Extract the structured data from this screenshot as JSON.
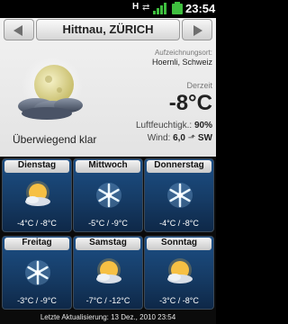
{
  "status_bar": {
    "indicator": "H",
    "time": "23:54",
    "colors": {
      "signal": "#3fbf3f",
      "battery": "#3fbf3f"
    }
  },
  "header": {
    "city": "Hittnau, ZÜRICH"
  },
  "current": {
    "station_label": "Aufzeichnungsort:",
    "station": "Hoernli, Schweiz",
    "now_label": "Derzeit",
    "temperature": "-8°C",
    "humidity_label": "Luftfeuchtigk.:",
    "humidity": "90%",
    "wind_label": "Wind:",
    "wind": "6,0",
    "wind_dir": "SW",
    "condition": "Überwiegend klar",
    "icon": "moon-clouds-icon"
  },
  "forecast": [
    {
      "day": "Dienstag",
      "icon": "sun-cloud-icon",
      "temps": "-4°C / -8°C"
    },
    {
      "day": "Mittwoch",
      "icon": "snowflake-icon",
      "temps": "-5°C / -9°C"
    },
    {
      "day": "Donnerstag",
      "icon": "snowflake-icon",
      "temps": "-4°C / -8°C"
    },
    {
      "day": "Freitag",
      "icon": "snowflake-icon",
      "temps": "-3°C / -9°C"
    },
    {
      "day": "Samstag",
      "icon": "sun-cloud-icon",
      "temps": "-7°C / -12°C"
    },
    {
      "day": "Sonntag",
      "icon": "sun-cloud-icon",
      "temps": "-3°C / -8°C"
    }
  ],
  "footer": {
    "text": "Letzte Aktualisierung: 13 Dez., 2010 23:54"
  }
}
